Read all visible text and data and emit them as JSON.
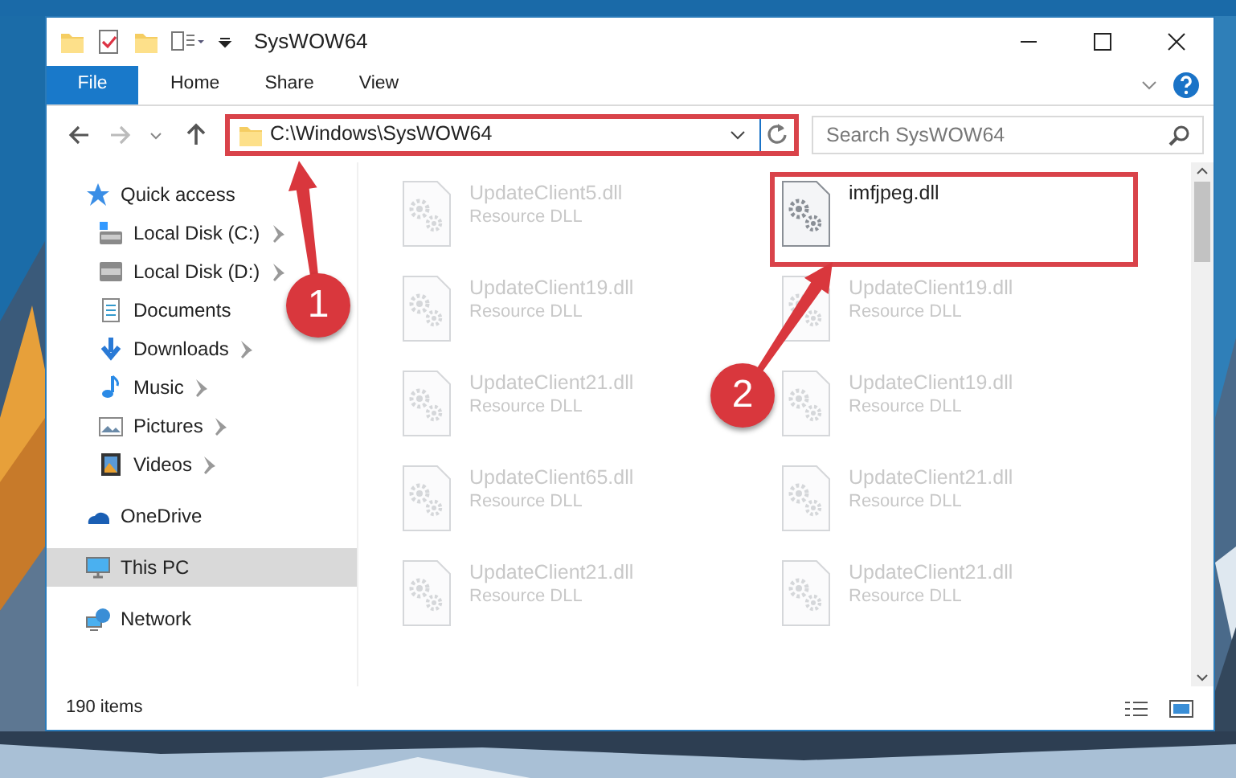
{
  "window": {
    "title": "SysWOW64"
  },
  "ribbon_tabs": [
    {
      "label": "File",
      "kind": "file",
      "selected": false
    },
    {
      "label": "Home",
      "kind": "tab",
      "selected": false
    },
    {
      "label": "Share",
      "kind": "tab",
      "selected": false
    },
    {
      "label": "View",
      "kind": "tab",
      "selected": false
    }
  ],
  "address_bar": {
    "path": "C:\\Windows\\SysWOW64",
    "highlighted": true
  },
  "search": {
    "placeholder": "Search SysWOW64"
  },
  "navigation": [
    {
      "label": "Quick access",
      "kind": "star",
      "selected": false,
      "children": [
        {
          "label": "Local Disk (C:)",
          "kind": "drive-c",
          "pinned": true,
          "selected": false
        },
        {
          "label": "Local Disk (D:)",
          "kind": "drive",
          "pinned": true,
          "selected": false
        },
        {
          "label": "Documents",
          "kind": "documents",
          "pinned": false,
          "selected": false
        },
        {
          "label": "Downloads",
          "kind": "downloads",
          "pinned": true,
          "selected": false
        },
        {
          "label": "Music",
          "kind": "music",
          "pinned": true,
          "selected": false
        },
        {
          "label": "Pictures",
          "kind": "pictures",
          "pinned": true,
          "selected": false
        },
        {
          "label": "Videos",
          "kind": "videos",
          "pinned": true,
          "selected": false
        }
      ]
    },
    {
      "label": "OneDrive",
      "kind": "cloud",
      "selected": false
    },
    {
      "label": "This PC",
      "kind": "pc",
      "selected": true
    },
    {
      "label": "Network",
      "kind": "network",
      "selected": false
    }
  ],
  "files": [
    {
      "name": "UpdateClient5.dll",
      "type": "Resource DLL",
      "dimmed": true,
      "highlighted": false
    },
    {
      "name": "imfjpeg.dll",
      "dimmed": false,
      "highlighted": true
    },
    {
      "name": "UpdateClient19.dll",
      "type": "Resource DLL",
      "dimmed": true,
      "highlighted": false
    },
    {
      "name": "UpdateClient19.dll",
      "type": "Resource DLL",
      "dimmed": true,
      "highlighted": false
    },
    {
      "name": "UpdateClient21.dll",
      "type": "Resource DLL",
      "dimmed": true,
      "highlighted": false
    },
    {
      "name": "UpdateClient19.dll",
      "type": "Resource DLL",
      "dimmed": true,
      "highlighted": false
    },
    {
      "name": "UpdateClient65.dll",
      "type": "Resource DLL",
      "dimmed": true,
      "highlighted": false
    },
    {
      "name": "UpdateClient21.dll",
      "type": "Resource DLL",
      "dimmed": true,
      "highlighted": false
    },
    {
      "name": "UpdateClient21.dll",
      "type": "Resource DLL",
      "dimmed": true,
      "highlighted": false
    },
    {
      "name": "UpdateClient21.dll",
      "type": "Resource DLL",
      "dimmed": true,
      "highlighted": false
    }
  ],
  "status_bar": {
    "item_count": "190 items"
  },
  "annotations": [
    {
      "label": "1"
    },
    {
      "label": "2"
    }
  ]
}
